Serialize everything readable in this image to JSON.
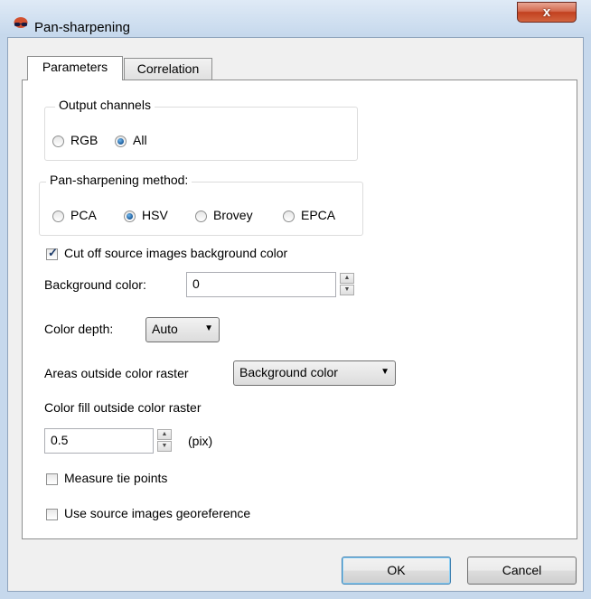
{
  "window": {
    "title": "Pan-sharpening",
    "close_glyph": "x",
    "icon": "app-glasses-icon"
  },
  "tabs": [
    {
      "label": "Parameters",
      "active": true
    },
    {
      "label": "Correlation",
      "active": false
    }
  ],
  "output_channels": {
    "legend": "Output channels",
    "options": [
      "RGB",
      "All"
    ],
    "selected": "All"
  },
  "method": {
    "legend": "Pan-sharpening method:",
    "options": [
      "PCA",
      "HSV",
      "Brovey",
      "EPCA"
    ],
    "selected": "HSV"
  },
  "cut_off": {
    "label": "Cut off source images background color",
    "checked": true
  },
  "background_color": {
    "label": "Background color:",
    "value": "0"
  },
  "color_depth": {
    "label": "Color depth:",
    "value": "Auto"
  },
  "areas_outside": {
    "label": "Areas outside color raster",
    "value": "Background color"
  },
  "color_fill": {
    "label": "Color fill outside color raster",
    "value": "0.5",
    "unit": "(pix)"
  },
  "measure_tie_points": {
    "label": "Measure tie points",
    "checked": false
  },
  "use_georeference": {
    "label": "Use source images georeference",
    "checked": false
  },
  "buttons": {
    "ok": "OK",
    "cancel": "Cancel"
  },
  "colors": {
    "accent_radio": "#1b5a99",
    "close_button": "#c2401f"
  }
}
